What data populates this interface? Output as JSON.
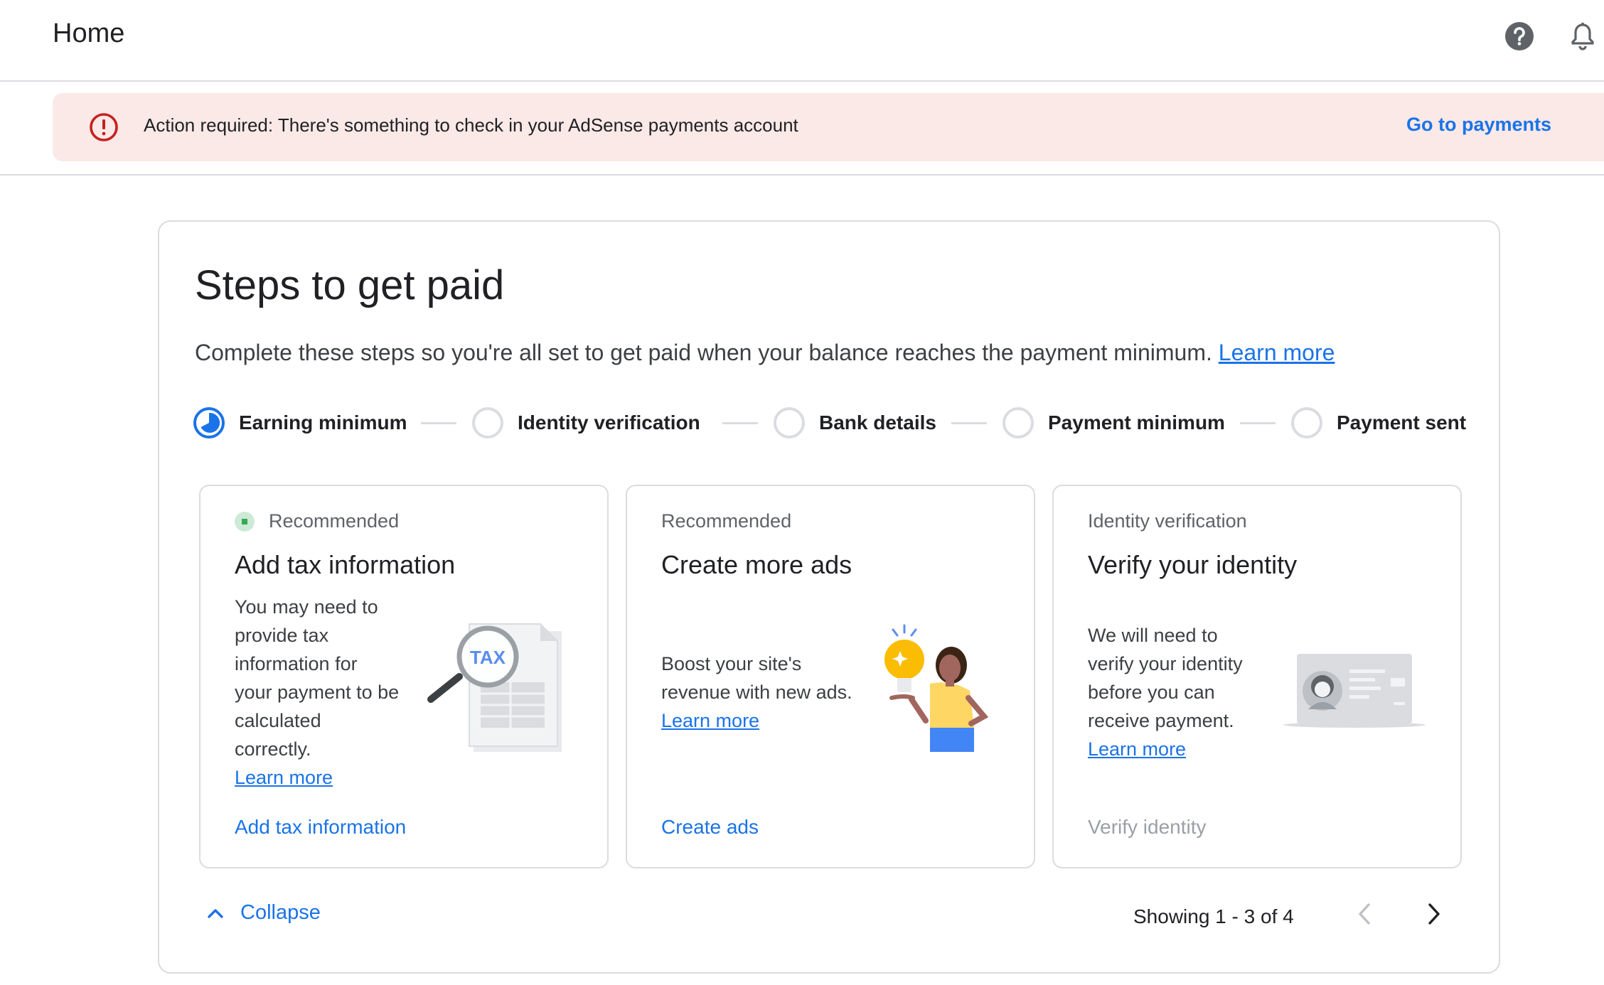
{
  "header": {
    "title": "Home",
    "help_icon": "help-circle-icon",
    "notifications_icon": "bell-icon"
  },
  "alert": {
    "icon": "error-icon",
    "message": "Action required: There's something to check in your AdSense payments account",
    "action_label": "Go to payments",
    "colors": {
      "background": "#fae9e7",
      "icon": "#c5221f",
      "link": "#1a73e8"
    }
  },
  "steps_card": {
    "title": "Steps to get paid",
    "description": "Complete these steps so you're all set to get paid when your balance reaches the payment minimum.",
    "learn_more": "Learn more",
    "steps": [
      {
        "label": "Earning minimum",
        "state": "in-progress"
      },
      {
        "label": "Identity verification",
        "state": "pending"
      },
      {
        "label": "Bank details",
        "state": "pending"
      },
      {
        "label": "Payment minimum",
        "state": "pending"
      },
      {
        "label": "Payment sent",
        "state": "pending"
      }
    ],
    "tasks": [
      {
        "tag": "Recommended",
        "title": "Add tax information",
        "body_lines": [
          "You may need to",
          "provide tax",
          "information for",
          "your payment to be",
          "calculated",
          "correctly."
        ],
        "learn_more": "Learn more",
        "action": "Add tax information",
        "illustration": "tax-document-illustration",
        "illustration_text": "TAX"
      },
      {
        "tag": "Recommended",
        "title": "Create more ads",
        "body_lines": [
          "Boost your site's",
          "revenue with new ads."
        ],
        "learn_more": "Learn more",
        "action": "Create ads",
        "illustration": "lightbulb-person-illustration"
      },
      {
        "tag": "Identity verification",
        "title": "Verify your identity",
        "body_lines": [
          "We will need to",
          "verify your identity",
          "before you can",
          "receive payment."
        ],
        "learn_more": "Learn more",
        "action": "Verify identity",
        "action_disabled": true,
        "illustration": "id-card-illustration"
      }
    ],
    "collapse_label": "Collapse",
    "pagination": {
      "text": "Showing 1 - 3 of 4",
      "prev_icon": "chevron-left-icon",
      "next_icon": "chevron-right-icon"
    },
    "colors": {
      "accent": "#1a73e8",
      "border": "#dadce0"
    }
  }
}
